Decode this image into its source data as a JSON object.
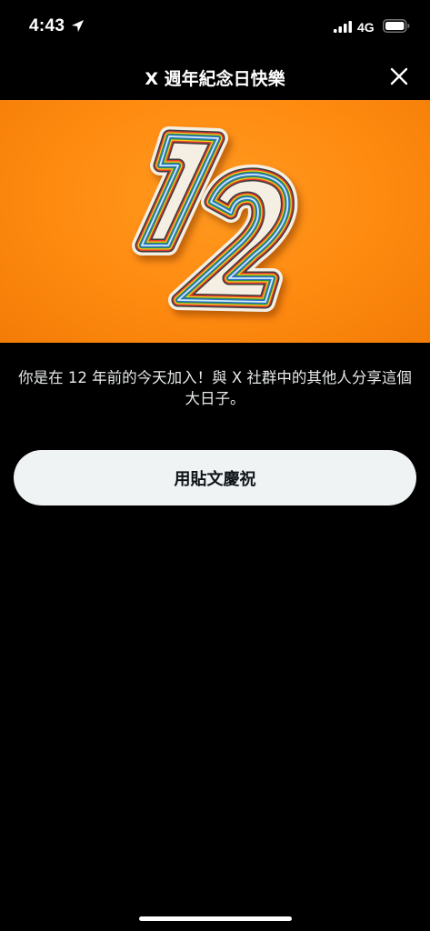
{
  "status_bar": {
    "time": "4:43",
    "network": "4G",
    "icons": [
      "location-arrow-icon",
      "cellular-signal-icon",
      "battery-icon"
    ]
  },
  "header": {
    "title": "X 週年紀念日快樂",
    "close_icon": "close-icon"
  },
  "hero": {
    "number": "12",
    "background_color": "#ff8a10"
  },
  "message": {
    "text": "你是在 12 年前的今天加入！與 X 社群中的其他人分享這個大日子。"
  },
  "actions": {
    "celebrate_label": "用貼文慶祝"
  },
  "colors": {
    "background": "#000000",
    "button_bg": "#eff3f4",
    "button_text": "#0f1419",
    "text": "#e7e9ea"
  }
}
